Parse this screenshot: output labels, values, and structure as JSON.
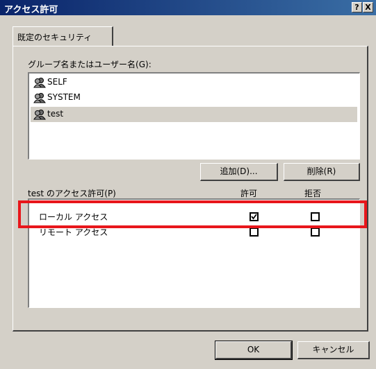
{
  "window": {
    "title": "アクセス許可",
    "help_button": "?",
    "close_button": "X"
  },
  "tabs": [
    {
      "label": "既定のセキュリティ"
    }
  ],
  "groups": {
    "label": "グループ名またはユーザー名(G):",
    "items": [
      {
        "name": "SELF",
        "icon": "user-group-icon"
      },
      {
        "name": "SYSTEM",
        "icon": "user-group-icon"
      },
      {
        "name": "test",
        "icon": "user-group-icon",
        "selected": true
      }
    ]
  },
  "buttons": {
    "add": "追加(D)...",
    "remove": "削除(R)",
    "ok": "OK",
    "cancel": "キャンセル"
  },
  "permissions": {
    "label": "test のアクセス許可(P)",
    "allow_header": "許可",
    "deny_header": "拒否",
    "rows": [
      {
        "name": "ローカル アクセス",
        "allow": true,
        "deny": false
      },
      {
        "name": "リモート アクセス",
        "allow": false,
        "deny": false
      }
    ]
  },
  "colors": {
    "highlight": "#e8161b",
    "titlebar": "#0a246a",
    "face": "#d4d0c8"
  }
}
